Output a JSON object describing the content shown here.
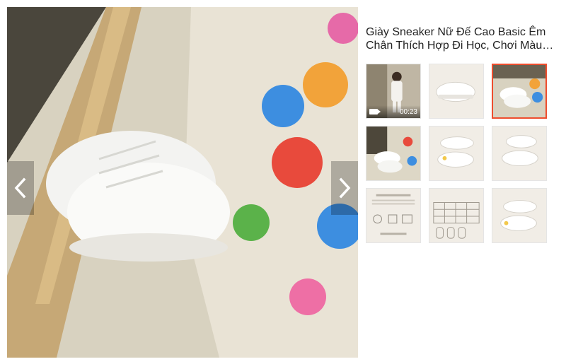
{
  "product": {
    "title": "Giày Sneaker Nữ Đế Cao Basic Êm Chân Thích Hợp Đi Học, Chơi Màu Trắng"
  },
  "gallery": {
    "video_duration": "00:23",
    "selected_index": 2,
    "thumbnails": [
      {
        "kind": "video"
      },
      {
        "kind": "image"
      },
      {
        "kind": "image"
      },
      {
        "kind": "image"
      },
      {
        "kind": "image"
      },
      {
        "kind": "image"
      },
      {
        "kind": "image"
      },
      {
        "kind": "image"
      },
      {
        "kind": "image"
      }
    ]
  },
  "colors": {
    "accent": "#ee4d2d"
  }
}
